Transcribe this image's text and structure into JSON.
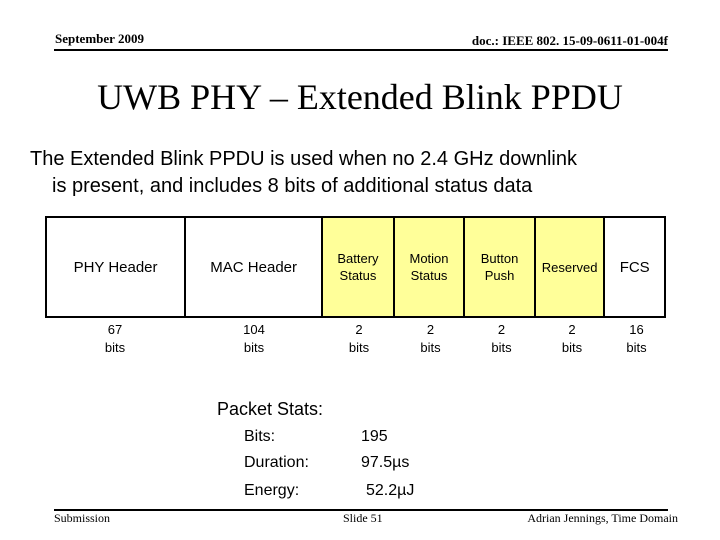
{
  "header": {
    "date": "September 2009",
    "doc_id": "doc.: IEEE 802. 15-09-0611-01-004f"
  },
  "title": "UWB PHY – Extended Blink PPDU",
  "subtitle": {
    "line1": "The Extended Blink PPDU is used when no 2.4 GHz downlink",
    "line2": "is present, and includes 8 bits of additional status data"
  },
  "packet": {
    "highlight_color": "#ffff99",
    "fields": [
      {
        "label": "PHY Header",
        "bits_value": "67",
        "bits_unit": "bits",
        "highlighted": false
      },
      {
        "label": "MAC Header",
        "bits_value": "104",
        "bits_unit": "bits",
        "highlighted": false
      },
      {
        "label": "Battery Status",
        "bits_value": "2",
        "bits_unit": "bits",
        "highlighted": true
      },
      {
        "label": "Motion Status",
        "bits_value": "2",
        "bits_unit": "bits",
        "highlighted": true
      },
      {
        "label": "Button Push",
        "bits_value": "2",
        "bits_unit": "bits",
        "highlighted": true
      },
      {
        "label": "Reserved",
        "bits_value": "2",
        "bits_unit": "bits",
        "highlighted": true
      },
      {
        "label": "FCS",
        "bits_value": "16",
        "bits_unit": "bits",
        "highlighted": false
      }
    ]
  },
  "stats": {
    "title": "Packet Stats:",
    "rows": [
      {
        "label": "Bits:",
        "value": "195"
      },
      {
        "label": "Duration:",
        "value": "97.5µs"
      },
      {
        "label": "Energy:",
        "value": "52.2µJ"
      }
    ]
  },
  "footer": {
    "left": "Submission",
    "center": "Slide 51",
    "right": "Adrian Jennings, Time Domain"
  }
}
